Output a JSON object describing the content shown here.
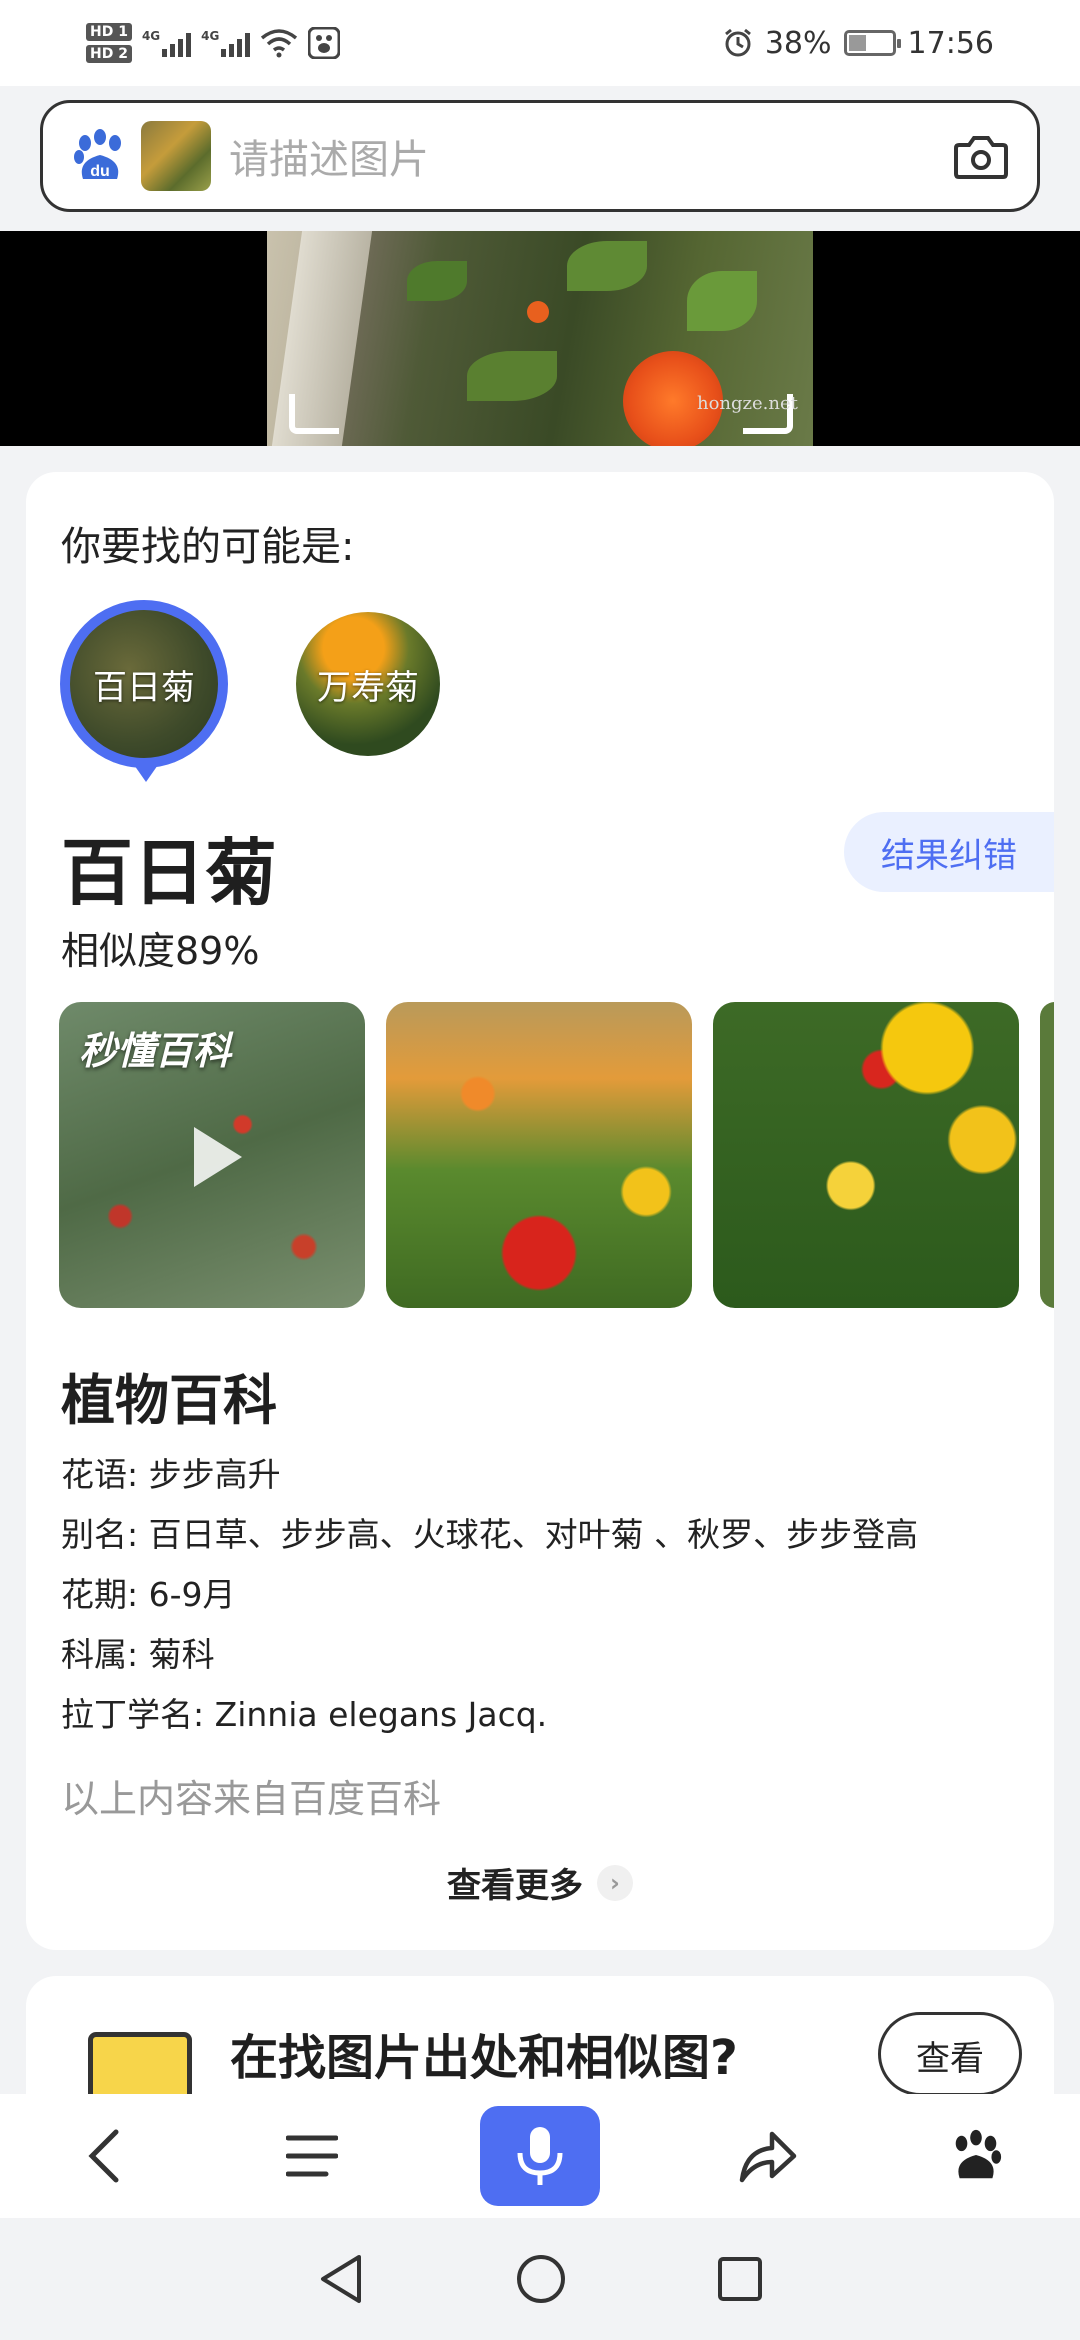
{
  "status_bar": {
    "network_1": "HD 1",
    "network_2": "HD 2",
    "signal_type": "4G",
    "battery": "38%",
    "time": "17:56"
  },
  "search": {
    "placeholder": "请描述图片"
  },
  "image_banner": {
    "watermark": "hongze.net"
  },
  "result_card": {
    "maybe_label": "你要找的可能是:",
    "candidates": [
      {
        "label": "百日菊",
        "selected": true
      },
      {
        "label": "万寿菊",
        "selected": false
      }
    ],
    "plant_name": "百日菊",
    "feedback_button": "结果纠错",
    "similarity": "相似度89%",
    "gallery": {
      "video_logo": "秒懂百科"
    },
    "encyclopedia": {
      "title": "植物百科",
      "rows": [
        "花语: 步步高升",
        "别名: 百日草、步步高、火球花、对叶菊 、秋罗、步步登高",
        "花期: 6-9月",
        "科属: 菊科",
        "拉丁学名: Zinnia elegans  Jacq."
      ],
      "source": "以上内容来自百度百科",
      "more_button": "查看更多"
    }
  },
  "source_card": {
    "title": "在找图片出处和相似图?",
    "button": "查看"
  },
  "colors": {
    "accent": "#4e6ef2",
    "feedback_bg": "#eaf0ff"
  }
}
